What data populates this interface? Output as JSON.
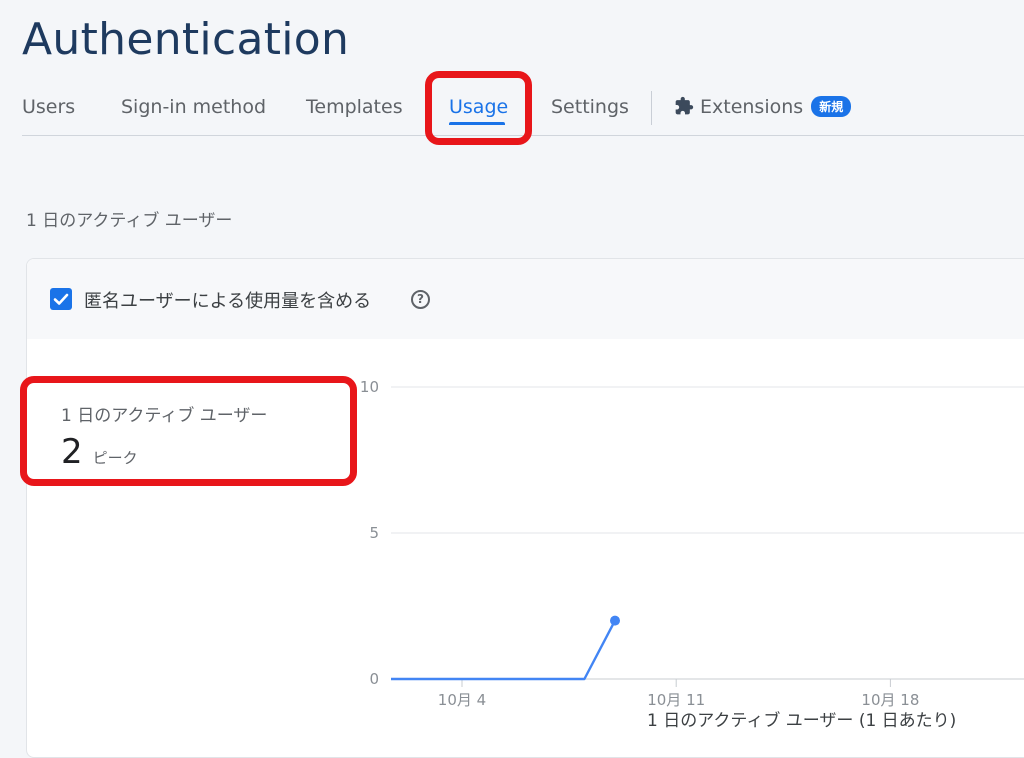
{
  "page": {
    "title": "Authentication"
  },
  "tabs": [
    {
      "label": "Users"
    },
    {
      "label": "Sign-in method"
    },
    {
      "label": "Templates"
    },
    {
      "label": "Usage",
      "active": true
    },
    {
      "label": "Settings"
    },
    {
      "label": "Extensions",
      "badge": "新規",
      "icon": "puzzle-icon"
    }
  ],
  "section": {
    "label": "1 日のアクティブ ユーザー"
  },
  "card": {
    "checkbox_label": "匿名ユーザーによる使用量を含める",
    "checkbox_checked": true,
    "help_icon": "?",
    "stat": {
      "label": "1 日のアクティブ ユーザー",
      "value": "2",
      "suffix": "ピーク"
    }
  },
  "colors": {
    "accent": "#1a73e8",
    "highlight": "#e8161a",
    "title": "#1e3a5f"
  },
  "chart_data": {
    "type": "line",
    "xlabel": "1 日のアクティブ ユーザー (1 日あたり)",
    "ylim": [
      0,
      10
    ],
    "y_ticks": [
      0,
      5,
      10
    ],
    "x_ticks": [
      "10月 4",
      "10月 11",
      "10月 18"
    ],
    "grid": true,
    "series": [
      {
        "x": [
          "10月 1",
          "10月 8",
          "10月 9"
        ],
        "values": [
          0,
          0,
          2
        ],
        "end_marker": true
      }
    ]
  }
}
